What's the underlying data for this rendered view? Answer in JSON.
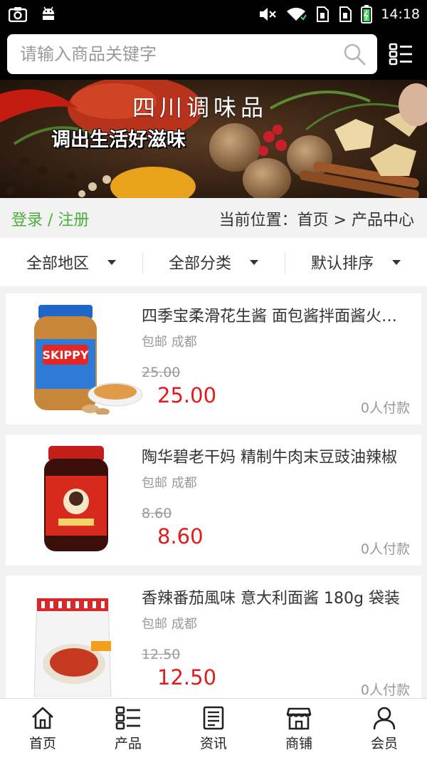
{
  "status_bar": {
    "time": "14:18",
    "left_icons": [
      "screenshot-icon",
      "android-icon"
    ],
    "right_icons": [
      "mute-icon",
      "wifi-icon",
      "sim1-icon",
      "sim2-icon",
      "battery-icon"
    ]
  },
  "search": {
    "placeholder": "请输入商品关键字",
    "value": ""
  },
  "banner": {
    "title": "四川调味品",
    "slogan": "调出生活好滋味"
  },
  "breadcrumb": {
    "login_register": "登录 / 注册",
    "location": "当前位置：首页 > 产品中心"
  },
  "filters": [
    {
      "label": "全部地区"
    },
    {
      "label": "全部分类"
    },
    {
      "label": "默认排序"
    }
  ],
  "products": [
    {
      "title": "四季宝柔滑花生酱 面包酱拌面酱火锅蘸料",
      "tags": "包邮 成都",
      "original_price": "25.00",
      "price": "25.00",
      "sold": "0人付款",
      "image_icon": "peanut-butter-jar-image"
    },
    {
      "title": "陶华碧老干妈 精制牛肉末豆豉油辣椒",
      "tags": "包邮 成都",
      "original_price": "8.60",
      "price": "8.60",
      "sold": "0人付款",
      "image_icon": "chili-sauce-jar-image"
    },
    {
      "title": "香辣番茄風味 意大利面酱 180g 袋装",
      "tags": "包邮 成都",
      "original_price": "12.50",
      "price": "12.50",
      "sold": "0人付款",
      "image_icon": "pasta-sauce-pouch-image"
    }
  ],
  "tabbar": [
    {
      "label": "首页",
      "icon": "home-icon"
    },
    {
      "label": "产品",
      "icon": "list-icon"
    },
    {
      "label": "资讯",
      "icon": "news-icon"
    },
    {
      "label": "商铺",
      "icon": "shop-icon"
    },
    {
      "label": "会员",
      "icon": "user-icon"
    }
  ],
  "colors": {
    "accent_green": "#4cae3a",
    "price_red": "#e21a1a",
    "header_bg": "#000000"
  }
}
